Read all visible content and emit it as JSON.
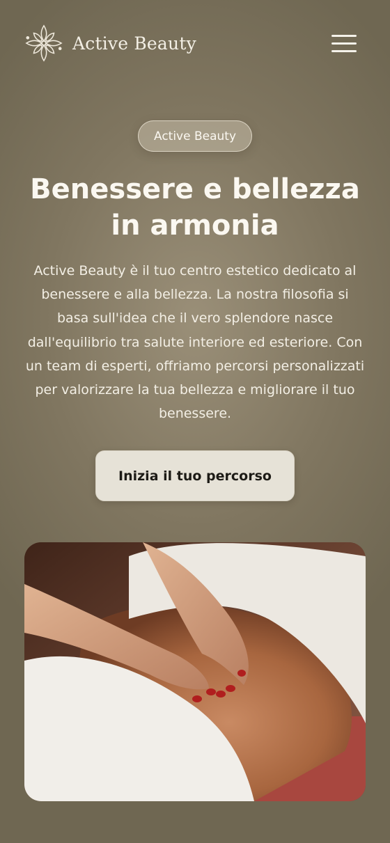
{
  "header": {
    "brand_name": "Active Beauty",
    "logo_icon": "floral-ornament-icon",
    "menu_icon": "hamburger-menu-icon"
  },
  "hero": {
    "badge": "Active Beauty",
    "title": "Benessere e bellezza in armonia",
    "description": "Active Beauty è il tuo centro estetico dedicato al benessere e alla bellezza. La nostra filosofia si basa sull'idea che il vero splendore nasce dall'equilibrio tra salute interiore ed esteriore. Con un team di esperti, offriamo percorsi personalizzati per valorizzare la tua bellezza e migliorare il tuo benessere.",
    "cta_label": "Inizia il tuo percorso"
  },
  "colors": {
    "background": "#807660",
    "button": "#e6e2d7",
    "text": "#fbf8f1"
  }
}
